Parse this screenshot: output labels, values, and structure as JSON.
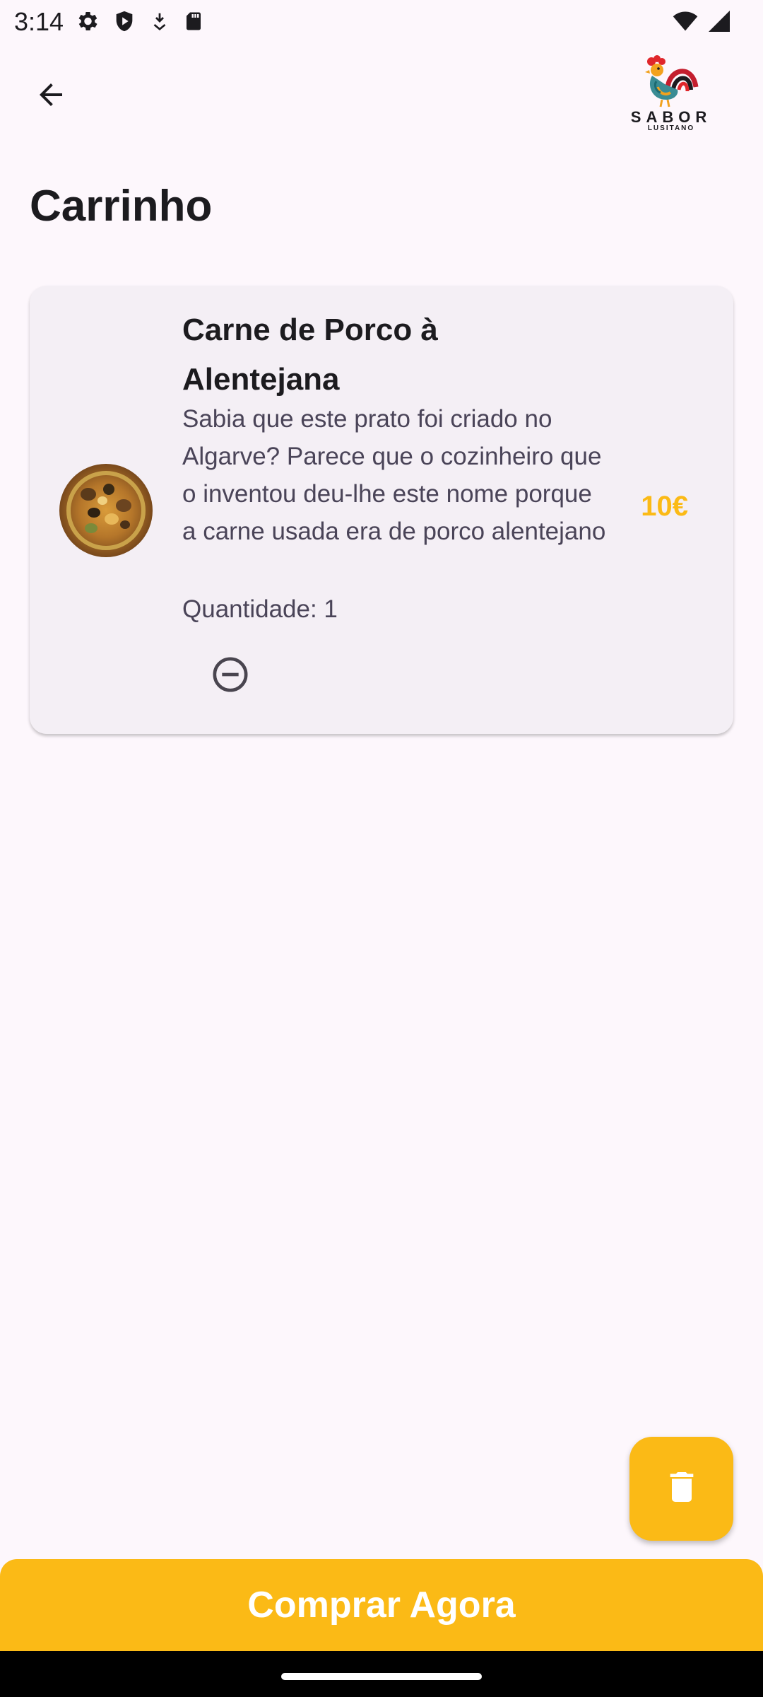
{
  "status_bar": {
    "time": "3:14",
    "left_icons": [
      "gear-icon",
      "shield-icon",
      "download-icon",
      "sd-card-icon"
    ],
    "right_icons": [
      "wifi-icon",
      "signal-icon"
    ]
  },
  "app_bar": {
    "back_icon": "arrow-back-icon",
    "logo": {
      "name": "SABOR",
      "sub": "LUSITANO"
    }
  },
  "page": {
    "title": "Carrinho"
  },
  "cart": {
    "items": [
      {
        "title": "Carne de Porco à Alentejana",
        "description": "Sabia que este prato foi criado no Algarve? Parece que o cozinheiro que o inventou deu-lhe este nome porque a carne usada era de porco alentejano",
        "quantity_text": "Quantidade: 1",
        "price": "10€",
        "remove_icon": "remove-circle-icon"
      }
    ]
  },
  "fab": {
    "icon": "trash-icon"
  },
  "buy_button": {
    "label": "Comprar Agora"
  },
  "colors": {
    "accent": "#FBBA16",
    "background": "#FDF7FC",
    "card": "#F4EFF5",
    "text": "#1C1B1F"
  }
}
